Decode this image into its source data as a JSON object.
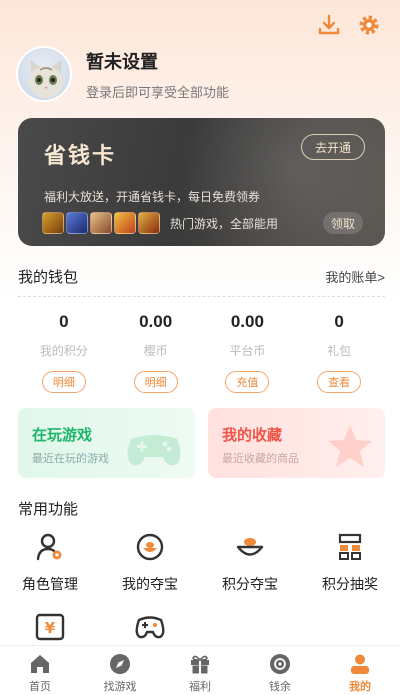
{
  "colors": {
    "accent": "#f08a3a",
    "card_dark": "#3f3f3f",
    "green": "#1fb56a",
    "red": "#f0554a"
  },
  "top_icons": [
    "download-icon",
    "gear-icon"
  ],
  "profile": {
    "name": "暂未设置",
    "tip": "登录后即可享受全部功能"
  },
  "card": {
    "title": "省钱卡",
    "open_label": "去开通",
    "desc": "福利大放送，开通省钱卡，每日免费领券",
    "games_text": "热门游戏，全部能用",
    "claim_label": "领取"
  },
  "wallet": {
    "title": "我的钱包",
    "link": "我的账单>",
    "items": [
      {
        "value": "0",
        "label": "我的积分",
        "button": "明细"
      },
      {
        "value": "0.00",
        "label": "樱币",
        "button": "明细"
      },
      {
        "value": "0.00",
        "label": "平台币",
        "button": "充值"
      },
      {
        "value": "0",
        "label": "礼包",
        "button": "查看"
      }
    ]
  },
  "tiles": {
    "play": {
      "title": "在玩游戏",
      "sub": "最近在玩的游戏"
    },
    "fav": {
      "title": "我的收藏",
      "sub": "最近收藏的商品"
    }
  },
  "functions": {
    "title": "常用功能",
    "items": [
      {
        "label": "角色管理",
        "icon": "role-manage-icon"
      },
      {
        "label": "我的夺宝",
        "icon": "treasure-icon"
      },
      {
        "label": "积分夺宝",
        "icon": "points-treasure-icon"
      },
      {
        "label": "积分抽奖",
        "icon": "lottery-icon"
      },
      {
        "label": "",
        "icon": "voucher-icon"
      },
      {
        "label": "",
        "icon": "gamepad-icon"
      }
    ]
  },
  "tabs": [
    {
      "label": "首页",
      "icon": "home-icon",
      "active": false
    },
    {
      "label": "找游戏",
      "icon": "compass-icon",
      "active": false
    },
    {
      "label": "福利",
      "icon": "gift-icon",
      "active": false
    },
    {
      "label": "钱余",
      "icon": "wallet-icon",
      "active": false
    },
    {
      "label": "我的",
      "icon": "user-icon",
      "active": true
    }
  ]
}
